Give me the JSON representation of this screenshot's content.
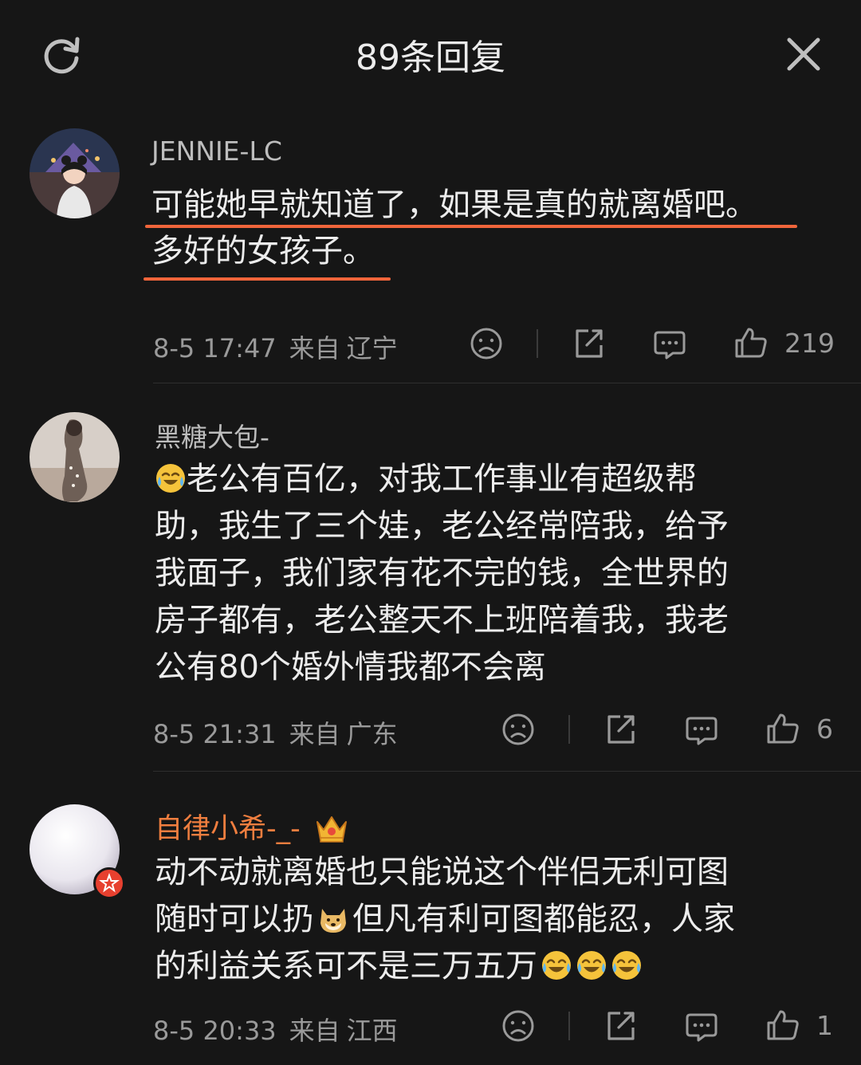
{
  "header": {
    "title": "89条回复"
  },
  "comments": [
    {
      "username": "JENNIE-LC",
      "username_color": "#bdbdbd",
      "lines": [
        "可能她早就知道了，如果是真的就离婚吧。",
        "多好的女孩子。"
      ],
      "time": "8-5 17:47",
      "from_label": "来自",
      "location": "辽宁",
      "likes": "219"
    },
    {
      "username": "黑糖大包-",
      "username_color": "#bdbdbd",
      "lines": [
        "老公有百亿，对我工作事业有超级帮",
        "助，我生了三个娃，老公经常陪我，给予",
        "我面子，我们家有花不完的钱，全世界的",
        "房子都有，老公整天不上班陪着我，我老",
        "公有80个婚外情我都不会离"
      ],
      "emoji_lead": "crying-laughing-emoji",
      "time": "8-5 21:31",
      "from_label": "来自",
      "location": "广东",
      "likes": "6"
    },
    {
      "username": "自律小希-_-",
      "username_color": "#f07e3f",
      "lines": [
        "动不动就离婚也只能说这个伴侣无利可图",
        "随时可以扔",
        "但凡有利可图都能忍，人家",
        "的利益关系可不是三万五万"
      ],
      "inline_emoji": "doge-emoji",
      "trailing_emojis": [
        "joy-emoji",
        "joy-emoji",
        "joy-emoji"
      ],
      "badge": "crown-badge-icon",
      "time": "8-5 20:33",
      "from_label": "来自",
      "location": "江西",
      "likes": "1"
    }
  ],
  "colors": {
    "background": "#161616",
    "underline": "#f0653b",
    "vip_name": "#f07e3f",
    "meta": "#9a9a9a"
  }
}
